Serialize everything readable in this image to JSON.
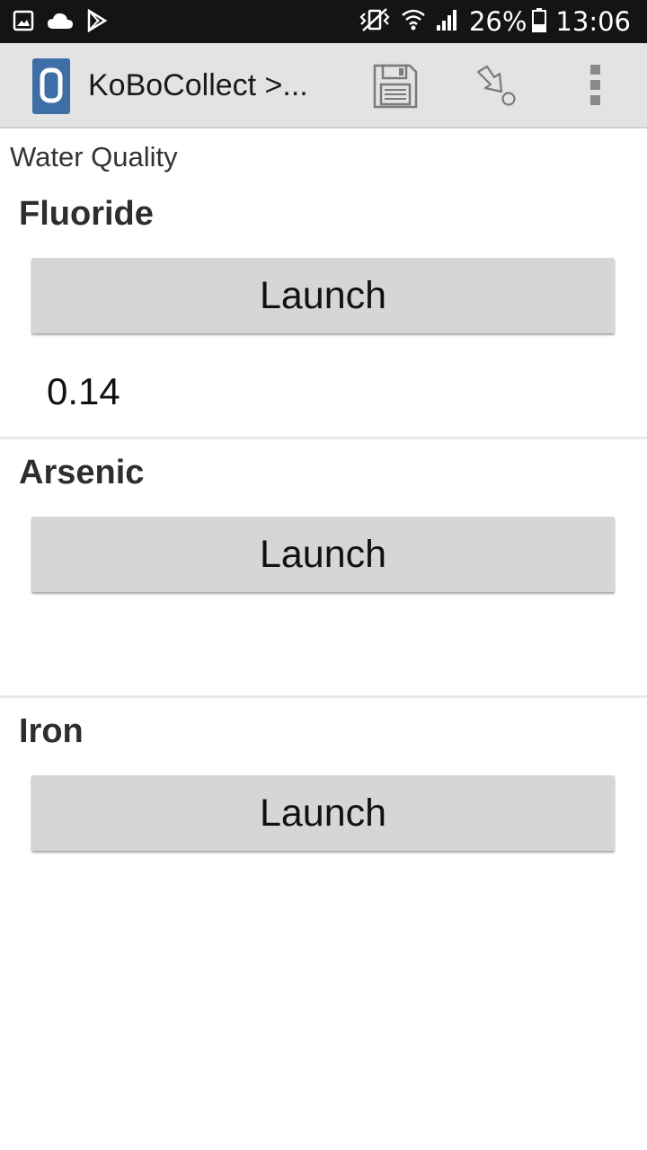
{
  "status_bar": {
    "battery": "26%",
    "time": "13:06",
    "left_icons": [
      "image-icon",
      "cloud-icon",
      "play-store-icon"
    ],
    "right_icons": [
      "vibrate-icon",
      "wifi-icon",
      "signal-icon",
      "battery-icon"
    ]
  },
  "app_bar": {
    "title": "KoBoCollect >...",
    "logo_icon": "kobo-logo-icon",
    "actions": [
      "save-icon",
      "go-to-icon",
      "overflow-menu-icon"
    ]
  },
  "group": {
    "label": "Water Quality"
  },
  "questions": [
    {
      "label": "Fluoride",
      "button": "Launch",
      "value": "0.14"
    },
    {
      "label": "Arsenic",
      "button": "Launch",
      "value": ""
    },
    {
      "label": "Iron",
      "button": "Launch",
      "value": ""
    }
  ],
  "colors": {
    "status_bar": "#141414",
    "app_bar": "#e3e3e3",
    "button": "#d6d6d6",
    "logo_blue": "#3d6fa6"
  }
}
